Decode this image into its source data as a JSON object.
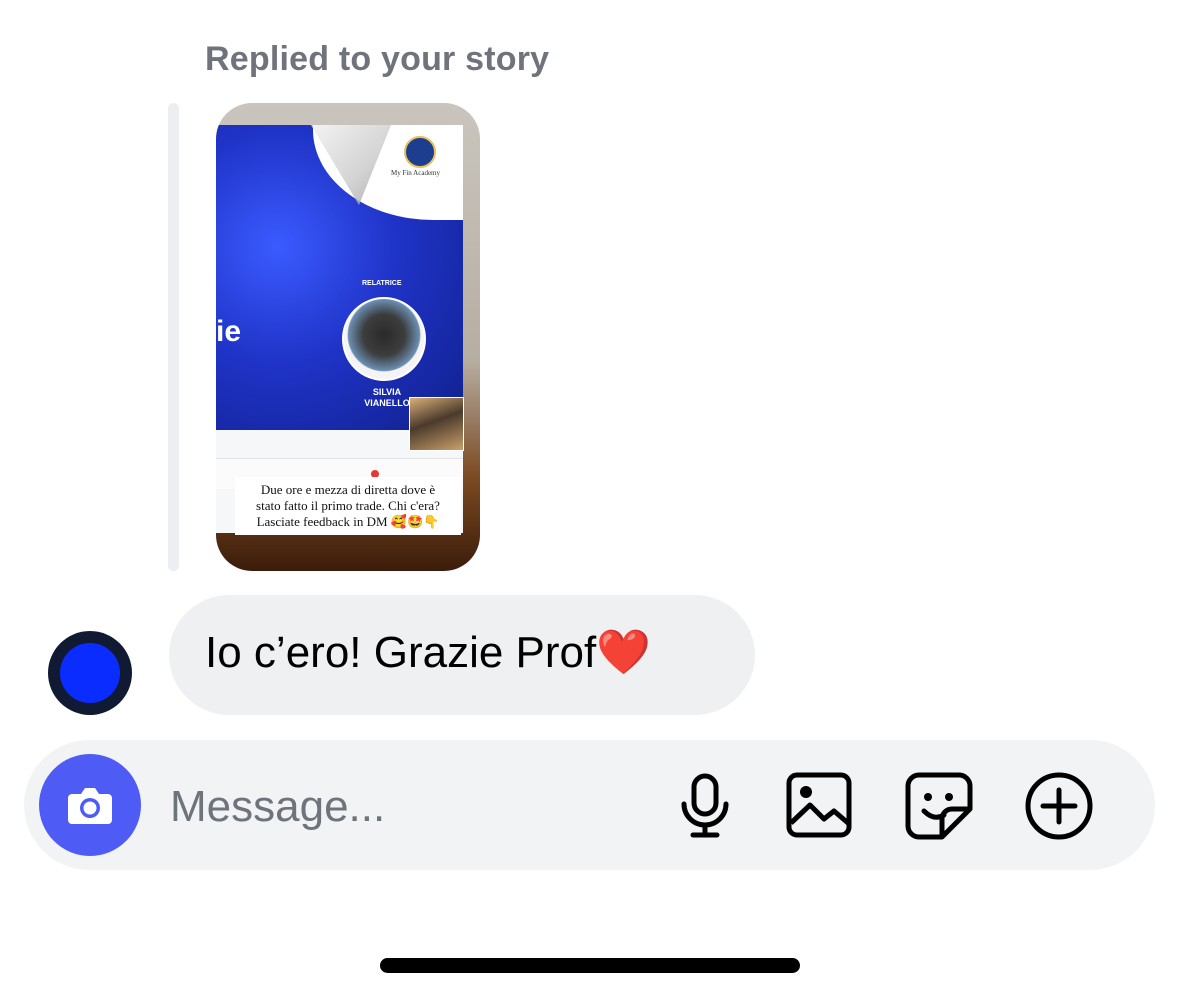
{
  "reply_label": "Replied to your story",
  "story": {
    "logo_text": "My Fin Academy",
    "partial_title": "ie",
    "speaker_tag": "RELATRICE",
    "speaker_name_line1": "SILVIA",
    "speaker_name_line2": "VIANELLO",
    "caption_line1": "Due ore e mezza di diretta dove è",
    "caption_line2": "stato fatto il primo trade. Chi c'era?",
    "caption_line3": "Lasciate feedback in DM 🥰🤩👇"
  },
  "message": {
    "text": "Io c’ero! Grazie Prof",
    "emoji": "❤️"
  },
  "composer": {
    "placeholder": "Message...",
    "camera_icon": "camera-icon",
    "mic_icon": "microphone-icon",
    "gallery_icon": "image-gallery-icon",
    "sticker_icon": "sticker-icon",
    "plus_icon": "plus-circle-icon"
  },
  "colors": {
    "camera_button": "#4f5bf5",
    "bubble": "#eff0f2",
    "composer": "#f2f3f5",
    "label_gray": "#6f737b"
  }
}
